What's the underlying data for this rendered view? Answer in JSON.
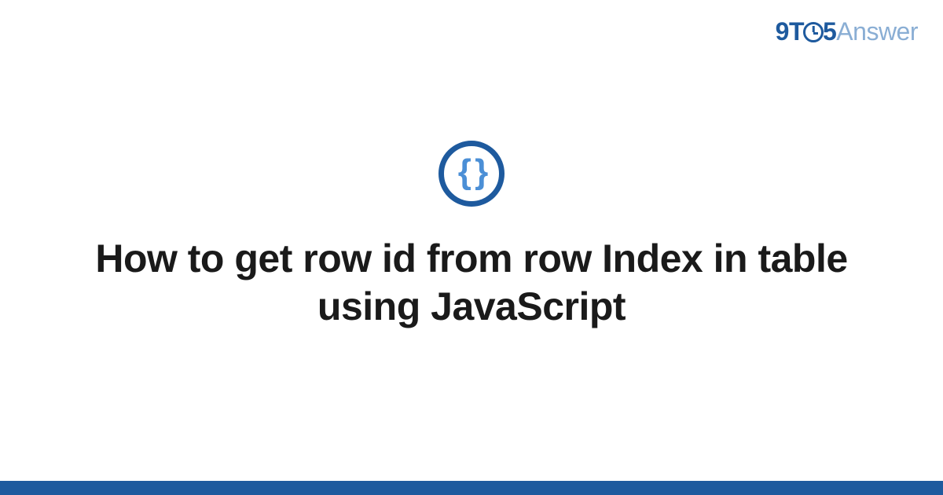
{
  "logo": {
    "part1": "9T",
    "part2": "5",
    "part3": "Answer"
  },
  "icon": {
    "glyph": "{ }",
    "name": "code-braces-icon"
  },
  "title": "How to get row id from row Index in table using JavaScript",
  "colors": {
    "primary": "#1e5a9e",
    "secondary": "#4b8fd6",
    "logo_light": "#8aaed4"
  }
}
